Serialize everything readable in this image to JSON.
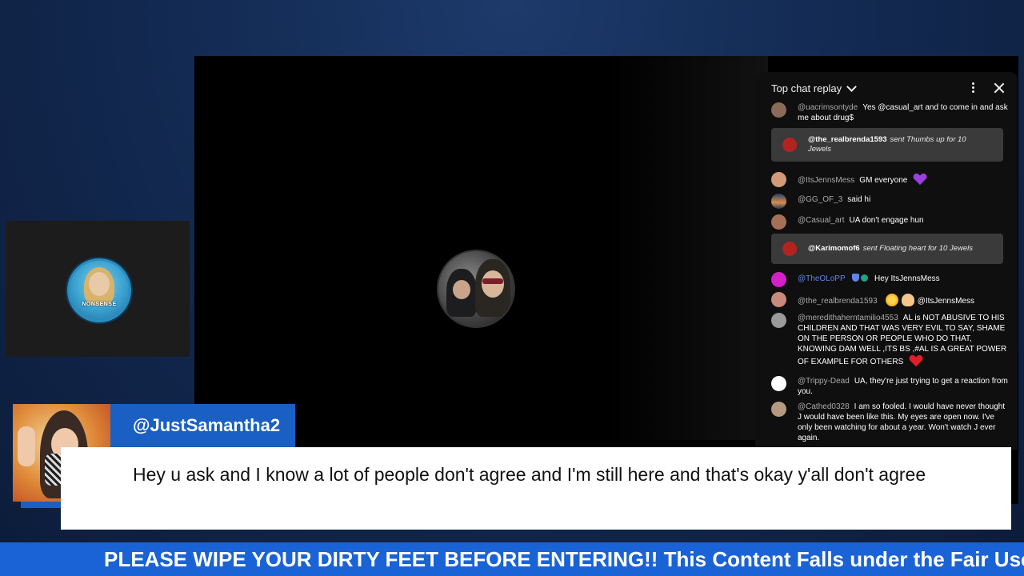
{
  "chat": {
    "title": "Top chat replay",
    "messages": [
      {
        "author": "@uacrimsontyde",
        "text": "Yes @casual_art and to come in and ask me about drug$",
        "avatar_color": "#8a6a58"
      },
      {
        "author": "@ItsJennsMess",
        "text": "GM everyone",
        "avatar_color": "#d39a7a"
      },
      {
        "author": "@GG_OF_3",
        "text": "said hi",
        "avatar_color": "#3b4d7a"
      },
      {
        "author": "@Casual_art",
        "text": "UA don't engage hun",
        "avatar_color": "#a47156"
      },
      {
        "author": "@TheOLoPP",
        "text": "Hey ItsJennsMess",
        "avatar_color": "#d321c7"
      },
      {
        "author": "@the_realbrenda1593",
        "text": "@ItsJennsMess",
        "avatar_color": "#c98a7c"
      },
      {
        "author": "@meredithaherntamilio4553",
        "text": "AL is NOT ABUSIVE TO HIS CHILDREN AND THAT WAS VERY EVIL TO SAY, SHAME ON THE PERSON OR PEOPLE WHO DO THAT, KNOWING DAM WELL ,ITS BS ,#AL IS A GREAT POWER OF EXAMPLE FOR OTHERS",
        "avatar_color": "#9a9a9a"
      },
      {
        "author": "@Trippy-Dead",
        "text": "UA, they're just trying to get a reaction from you.",
        "avatar_color": "#ffffff"
      },
      {
        "author": "@Cathed0328",
        "text": "I am so fooled. I would have never thought J would have been like this. My eyes are open now. I've only been watching for about a year. Won't watch J ever again.",
        "avatar_color": "#b59a80"
      }
    ],
    "gifts": [
      {
        "author": "@the_realbrenda1593",
        "text": "sent Thumbs up for 10 Jewels"
      },
      {
        "author": "@Karimomof6",
        "text": "sent Floating heart for 10 Jewels"
      }
    ]
  },
  "lower_third": {
    "name": "@JustSamantha2",
    "message": "Hey u ask and I know a lot of people don't agree and I'm still here and that's okay y'all don't agree"
  },
  "ticker": {
    "text": "PLEASE WIPE YOUR DIRTY FEET BEFORE ENTERING!! This Content Falls under the Fair Use Dis"
  },
  "logo": {
    "text": "NONSENSE"
  },
  "colors": {
    "accent_blue": "#1a5fc4",
    "ticker_blue": "#1a63d6",
    "chat_bg": "#0f0f0f",
    "gift_bg": "#3a3a3a",
    "member_name": "#5e84f1"
  }
}
